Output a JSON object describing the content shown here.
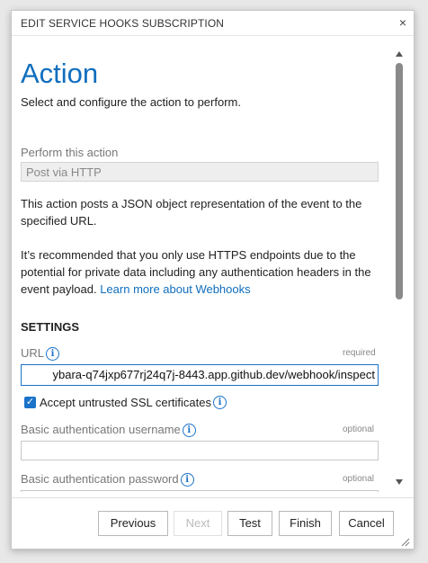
{
  "dialog": {
    "title": "EDIT SERVICE HOOKS SUBSCRIPTION",
    "close_glyph": "×",
    "close_icon": "close-icon"
  },
  "content": {
    "heading": "Action",
    "subheading": "Select and configure the action to perform.",
    "perform_label": "Perform this action",
    "perform_value": "Post via HTTP",
    "description": "This action posts a JSON object representation of the event to the specified URL.",
    "recommendation": "It’s recommended that you only use HTTPS endpoints due to the potential for private data including any authentication headers in the event payload.",
    "learn_more_link": "Learn more about Webhooks",
    "settings_heading": "SETTINGS",
    "url_label": "URL",
    "url_required": "required",
    "url_value": "ybara-q74jxp677rj24q7j-8443.app.github.dev/webhook/inspect",
    "accept_ssl_label": "Accept untrusted SSL certificates",
    "accept_ssl_checked": true,
    "username_label": "Basic authentication username",
    "username_optional": "optional",
    "username_value": "",
    "password_label": "Basic authentication password",
    "password_optional": "optional",
    "password_value": "",
    "info_glyph": "i"
  },
  "footer": {
    "previous": "Previous",
    "next": "Next",
    "test": "Test",
    "finish": "Finish",
    "cancel": "Cancel"
  },
  "colors": {
    "accent": "#106ebe",
    "info": "#1a73c8"
  }
}
